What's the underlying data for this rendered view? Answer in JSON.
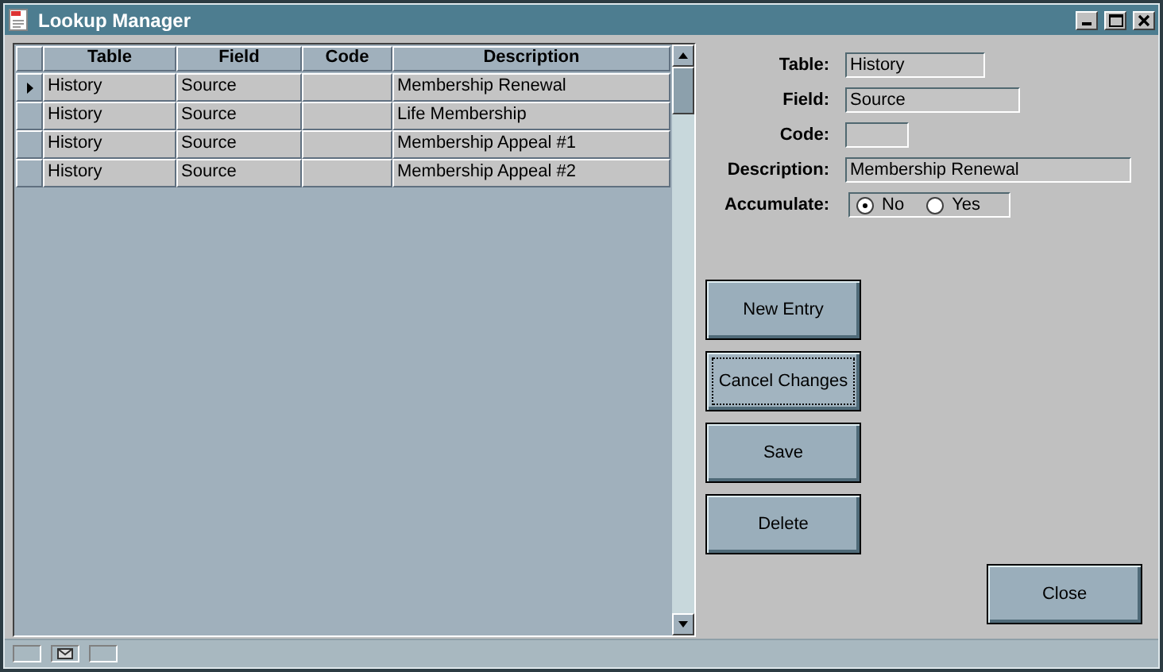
{
  "window": {
    "title": "Lookup Manager"
  },
  "table": {
    "columns": [
      "Table",
      "Field",
      "Code",
      "Description"
    ],
    "rows": [
      {
        "selected": true,
        "cells": [
          "History",
          "Source",
          "",
          "Membership Renewal"
        ]
      },
      {
        "selected": false,
        "cells": [
          "History",
          "Source",
          "",
          "Life Membership"
        ]
      },
      {
        "selected": false,
        "cells": [
          "History",
          "Source",
          "",
          "Membership Appeal #1"
        ]
      },
      {
        "selected": false,
        "cells": [
          "History",
          "Source",
          "",
          "Membership Appeal #2"
        ]
      }
    ]
  },
  "form": {
    "fields": [
      {
        "label": "Table:",
        "value": "History"
      },
      {
        "label": "Field:",
        "value": "Source"
      },
      {
        "label": "Code:"
      },
      {
        "label": "Description:",
        "value": "Membership Renewal"
      }
    ],
    "accumulate": {
      "label": "Accumulate:",
      "options": [
        {
          "label": "No",
          "selected": true
        },
        {
          "label": "Yes",
          "selected": false
        }
      ]
    }
  },
  "buttons": [
    {
      "label": "New Entry",
      "focused": false
    },
    {
      "label": "Cancel Changes",
      "focused": true
    },
    {
      "label": "Save",
      "focused": false
    },
    {
      "label": "Delete",
      "focused": false
    }
  ],
  "close_button": {
    "label": "Close"
  }
}
